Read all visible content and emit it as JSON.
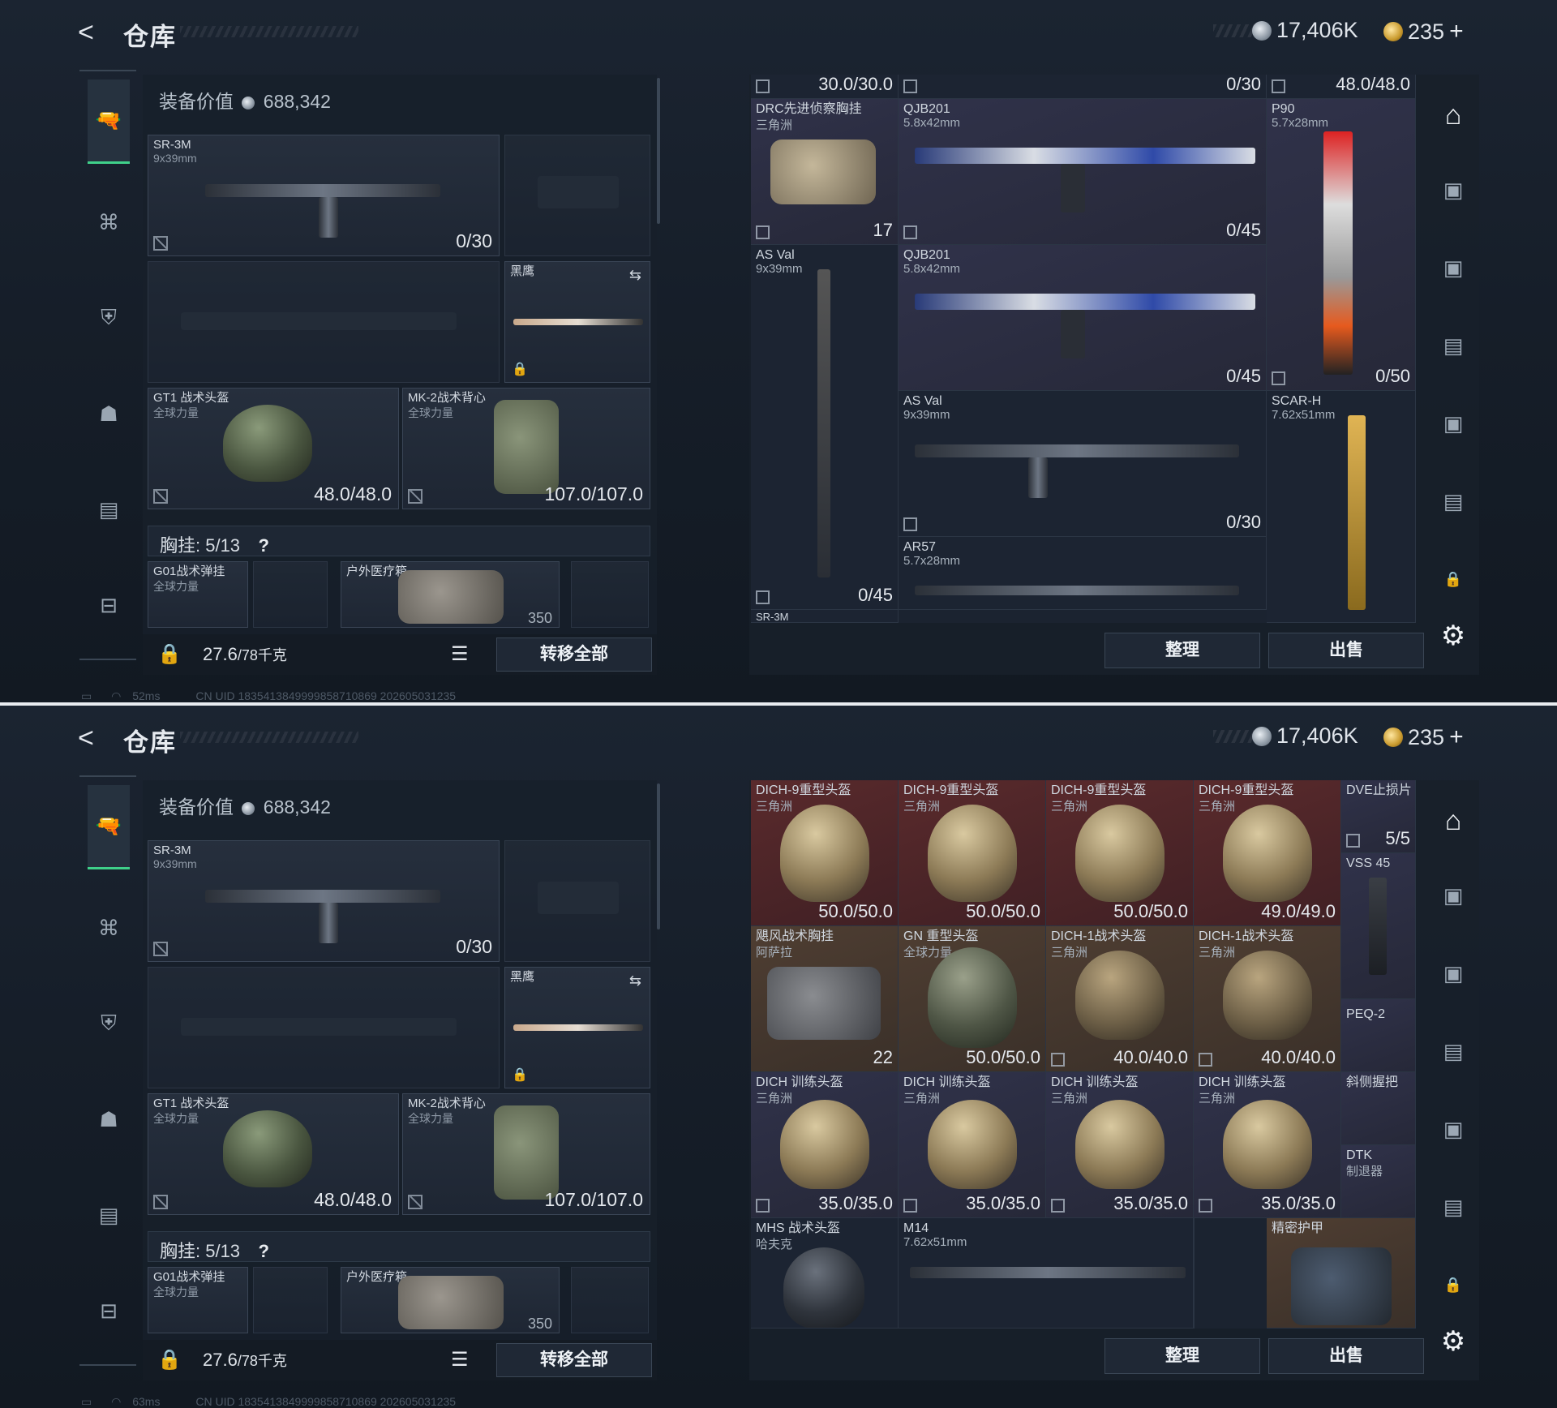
{
  "screens": [
    {
      "header": {
        "back": "<",
        "title": "仓库",
        "currency_silver": "17,406K",
        "currency_gold": "235",
        "plus": "+"
      },
      "left": {
        "equip_value_label": "装备价值",
        "equip_value": "688,342",
        "primary": {
          "name": "SR-3M",
          "caliber": "9x39mm",
          "ammo": "0/30"
        },
        "knife": {
          "name": "黑鹰"
        },
        "helmet": {
          "name": "GT1 战术头盔",
          "faction": "全球力量",
          "durability": "48.0/48.0"
        },
        "armor": {
          "name": "MK-2战术背心",
          "faction": "全球力量",
          "durability": "107.0/107.0"
        },
        "chest_label": "胸挂: 5/13",
        "chest_item1": {
          "name": "G01战术弹挂",
          "faction": "全球力量"
        },
        "chest_item2": {
          "name": "户外医疗箱",
          "val": "350"
        },
        "weight": "27.6",
        "weight_unit": "/78千克",
        "transfer_all": "转移全部"
      },
      "right": {
        "items": [
          {
            "name": "",
            "sub": "",
            "val": "30.0/30.0"
          },
          {
            "name": "",
            "sub": "",
            "val": "0/30"
          },
          {
            "name": "",
            "sub": "",
            "val": "48.0/48.0"
          },
          {
            "name": "DRC先进侦察胸挂",
            "sub": "三角洲",
            "val": "17"
          },
          {
            "name": "QJB201",
            "sub": "5.8x42mm",
            "val": "0/45"
          },
          {
            "name": "P90",
            "sub": "5.7x28mm",
            "val": "0/50"
          },
          {
            "name": "AS Val",
            "sub": "9x39mm",
            "val": "0/45"
          },
          {
            "name": "QJB201",
            "sub": "5.8x42mm",
            "val": "0/45"
          },
          {
            "name": "AS Val",
            "sub": "9x39mm",
            "val": "0/30"
          },
          {
            "name": "SCAR-H",
            "sub": "7.62x51mm",
            "val": ""
          },
          {
            "name": "AR57",
            "sub": "5.7x28mm",
            "val": ""
          },
          {
            "name": "SR-3M",
            "sub": "",
            "val": ""
          }
        ],
        "sort_btn": "整理",
        "sell_btn": "出售"
      },
      "status": {
        "ping": "52ms",
        "uid": "CN UID 1835413849999858710869 202605031235"
      }
    },
    {
      "header": {
        "back": "<",
        "title": "仓库",
        "currency_silver": "17,406K",
        "currency_gold": "235",
        "plus": "+"
      },
      "left": {
        "equip_value_label": "装备价值",
        "equip_value": "688,342",
        "primary": {
          "name": "SR-3M",
          "caliber": "9x39mm",
          "ammo": "0/30"
        },
        "knife": {
          "name": "黑鹰"
        },
        "helmet": {
          "name": "GT1 战术头盔",
          "faction": "全球力量",
          "durability": "48.0/48.0"
        },
        "armor": {
          "name": "MK-2战术背心",
          "faction": "全球力量",
          "durability": "107.0/107.0"
        },
        "chest_label": "胸挂: 5/13",
        "chest_item1": {
          "name": "G01战术弹挂",
          "faction": "全球力量"
        },
        "chest_item2": {
          "name": "户外医疗箱",
          "val": "350"
        },
        "weight": "27.6",
        "weight_unit": "/78千克",
        "transfer_all": "转移全部"
      },
      "right": {
        "items": [
          {
            "name": "DICH-9重型头盔",
            "sub": "三角洲",
            "val": "50.0/50.0"
          },
          {
            "name": "DICH-9重型头盔",
            "sub": "三角洲",
            "val": "50.0/50.0"
          },
          {
            "name": "DICH-9重型头盔",
            "sub": "三角洲",
            "val": "50.0/50.0"
          },
          {
            "name": "DICH-9重型头盔",
            "sub": "三角洲",
            "val": "49.0/49.0"
          },
          {
            "name": "DVE止损片",
            "sub": "",
            "val": "5/5"
          },
          {
            "name": "飓风战术胸挂",
            "sub": "阿萨拉",
            "val": "22"
          },
          {
            "name": "GN 重型头盔",
            "sub": "全球力量",
            "val": "50.0/50.0"
          },
          {
            "name": "DICH-1战术头盔",
            "sub": "三角洲",
            "val": "40.0/40.0"
          },
          {
            "name": "DICH-1战术头盔",
            "sub": "三角洲",
            "val": "40.0/40.0"
          },
          {
            "name": "VSS 45",
            "sub": "",
            "val": ""
          },
          {
            "name": "PEQ-2",
            "sub": "",
            "val": ""
          },
          {
            "name": "DICH 训练头盔",
            "sub": "三角洲",
            "val": "35.0/35.0"
          },
          {
            "name": "DICH 训练头盔",
            "sub": "三角洲",
            "val": "35.0/35.0"
          },
          {
            "name": "DICH 训练头盔",
            "sub": "三角洲",
            "val": "35.0/35.0"
          },
          {
            "name": "DICH 训练头盔",
            "sub": "三角洲",
            "val": "35.0/35.0"
          },
          {
            "name": "斜侧握把",
            "sub": "",
            "val": ""
          },
          {
            "name": "DTK",
            "sub": "制退器",
            "val": ""
          },
          {
            "name": "MHS 战术头盔",
            "sub": "哈夫克",
            "val": ""
          },
          {
            "name": "M14",
            "sub": "7.62x51mm",
            "val": ""
          },
          {
            "name": "精密护甲",
            "sub": "",
            "val": ""
          }
        ],
        "sort_btn": "整理",
        "sell_btn": "出售"
      },
      "status": {
        "ping": "63ms",
        "uid": "CN UID 1835413849999858710869 202605031235"
      }
    }
  ],
  "colors": {
    "accent": "#3fd18a",
    "cell_red": "#5a2a2c",
    "cell_brown": "#4f3e32",
    "cell_purple": "#30324a"
  }
}
